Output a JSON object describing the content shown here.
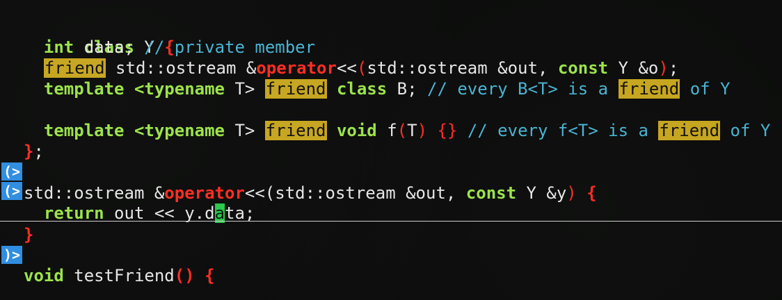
{
  "editor": {
    "lines": {
      "l1": {
        "kw_class": "class",
        "name": " Y ",
        "brace": "{"
      },
      "l2": {
        "kw_int": "int",
        "rest": " data; ",
        "comment": "// private member"
      },
      "l3": {
        "friend": "friend",
        "t1": " std::ostream &",
        "op": "operator",
        "t2": "<<",
        "p1": "(",
        "t3": "std::ostream &out, ",
        "kw_const": "const",
        "t4": " Y &o",
        "p2": ")",
        "t5": ";"
      },
      "l4": {
        "kw_template": "template",
        "t1": " <",
        "kw_typename": "typename",
        "t2": " T> ",
        "friend": "friend",
        "t3": " ",
        "kw_class": "class",
        "t4": " B; ",
        "c1": "// every B<T> is a ",
        "friend2": "friend",
        "c2": " of Y"
      },
      "l5": {
        "kw_template": "template",
        "t1": " <",
        "kw_typename": "typename",
        "t2": " T> ",
        "friend": "friend",
        "t3": " ",
        "kw_void": "void",
        "t4": " f",
        "p1": "(",
        "t5": "T",
        "p2": ")",
        "t6": " ",
        "br": "{}",
        "t7": " ",
        "c1": "// every f<T> is a ",
        "friend2": "friend",
        "c2": " of Y"
      },
      "l6": {
        "close": "}",
        "semi": ";"
      },
      "l7": {
        "t1": "std::ostream &",
        "op": "operator",
        "t2": "<<",
        "p1": "(",
        "t3": "std::ostream &out, ",
        "kw_const": "const",
        "t4": " Y &y",
        "p2": ")",
        "t5": " ",
        "brace": "{"
      },
      "l8": {
        "kw_return": "return",
        "t1": " out << y.d",
        "cursor_char": "a",
        "t2": "ta;"
      },
      "l9": {
        "close": "}"
      },
      "l10": {
        "kw_void": "void",
        "t1": " testFriend",
        "parens": "()",
        "t2": " ",
        "brace": "{"
      }
    },
    "gutter": {
      "mark1": "(>",
      "mark2": "(>",
      "mark3": ")>"
    }
  }
}
